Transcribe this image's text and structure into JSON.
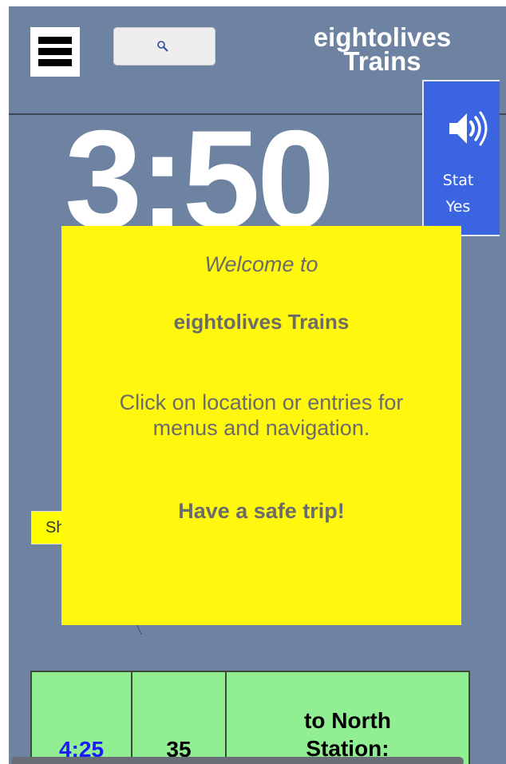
{
  "header": {
    "app_title": "eightolives\nTrains",
    "menu_icon": "hamburger-menu-icon",
    "search_icon": "magnifier-icon"
  },
  "clock": {
    "time": "3:50"
  },
  "status": {
    "icon": "speaker-volume-icon",
    "label": "Stat",
    "value": "Yes"
  },
  "side_chip": {
    "label": "Sh"
  },
  "welcome": {
    "greeting": "Welcome to",
    "name": "eightolives Trains",
    "instructions": "Click on location or entries for menus and navigation.",
    "farewell": "Have a safe trip!"
  },
  "departures": [
    {
      "time": "4:25",
      "number": "35",
      "destination": "to North Station:"
    }
  ],
  "colors": {
    "background": "#6e82a2",
    "popup": "#fff70d",
    "status_panel": "#3a64e0",
    "departure_row": "#92ee92",
    "departure_time": "#1a1aff"
  }
}
